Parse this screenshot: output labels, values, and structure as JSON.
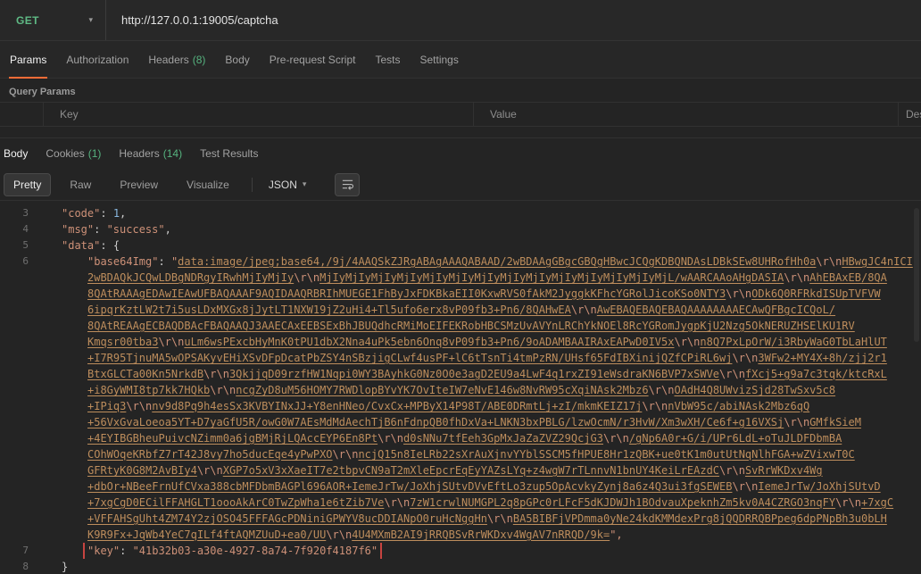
{
  "colors": {
    "accent": "#ff6c37",
    "method_get": "#5fba85",
    "count_green": "#56b37f",
    "string": "#ce9178",
    "link": "#bd8d5c",
    "number": "#89b8e0",
    "punct": "#cccccc",
    "line_number": "#6f6f6f",
    "highlight_red": "#c74440"
  },
  "request": {
    "method": "GET",
    "url": "http://127.0.0.1:19005/captcha",
    "tabs": [
      {
        "label": "Params",
        "active": true
      },
      {
        "label": "Authorization"
      },
      {
        "label": "Headers",
        "count": "(8)"
      },
      {
        "label": "Body"
      },
      {
        "label": "Pre-request Script"
      },
      {
        "label": "Tests"
      },
      {
        "label": "Settings"
      }
    ],
    "query_params_label": "Query Params",
    "param_columns": [
      "Key",
      "Value",
      "Description"
    ]
  },
  "response": {
    "tabs": [
      {
        "label": "Body",
        "active": true
      },
      {
        "label": "Cookies",
        "count": "(1)"
      },
      {
        "label": "Headers",
        "count": "(14)"
      },
      {
        "label": "Test Results"
      }
    ],
    "views": [
      {
        "label": "Pretty",
        "active": true
      },
      {
        "label": "Raw"
      },
      {
        "label": "Preview"
      },
      {
        "label": "Visualize"
      }
    ],
    "format": "JSON",
    "body_lines": [
      {
        "num": "3",
        "ind": 1,
        "parts": [
          [
            "k",
            "\"code\""
          ],
          [
            "p",
            ": "
          ],
          [
            "n",
            "1"
          ],
          [
            "p",
            ","
          ]
        ]
      },
      {
        "num": "4",
        "ind": 1,
        "parts": [
          [
            "k",
            "\"msg\""
          ],
          [
            "p",
            ": "
          ],
          [
            "s",
            "\"success\""
          ],
          [
            "p",
            ","
          ]
        ]
      },
      {
        "num": "5",
        "ind": 1,
        "parts": [
          [
            "k",
            "\"data\""
          ],
          [
            "p",
            ": "
          ],
          [
            "p",
            "{"
          ]
        ]
      },
      {
        "num": "6",
        "ind": 2,
        "parts": [
          [
            "k",
            "\"base64Img\""
          ],
          [
            "p",
            ": "
          ],
          [
            "s",
            "\""
          ],
          [
            "l",
            "data:image/jpeg;base64,/9j/4AAQSkZJRgABAgAAAQABAAD/2wBDAAgGBgcGBQgHBwcJCQgKDBQNDAsLDBkSEw8UHRofHh0a"
          ],
          [
            "c",
            "\\r\\n"
          ],
          [
            "l",
            "HBwgJC4nICI"
          ]
        ]
      },
      {
        "num": "",
        "ind": 2,
        "parts": [
          [
            "l",
            "2wBDAQkJCQwLDBgNDRgyIRwhMjIyMjIy"
          ],
          [
            "c",
            "\\r\\n"
          ],
          [
            "l",
            "MjIyMjIyMjIyMjIyMjIyMjIyMjIyMjIyMjIyMjIyMjIyMjIyMjIyMjL/wAARCAAoAHgDASIA"
          ],
          [
            "c",
            "\\r\\n"
          ],
          [
            "l",
            "AhEBAxEB/8QA"
          ]
        ]
      },
      {
        "num": "",
        "ind": 2,
        "parts": [
          [
            "l",
            "8QAtRAAAgEDAwIEAwUFBAQAAAF9AQIDAAQRBRIhMUEGE1FhByJxFDKBkaEII0KxwRVS0fAkM2JyggkKFhcYGRolJicoKSo0NTY3"
          ],
          [
            "c",
            "\\r\\n"
          ],
          [
            "l",
            "ODk6Q0RFRkdISUpTVFVW"
          ]
        ]
      },
      {
        "num": "",
        "ind": 2,
        "parts": [
          [
            "l",
            "6ipqrKztLW2t7i5usLDxMXGx8jJytLT1NXW19jZ2uHi4+Tl5ufo6erx8vP09fb3+Pn6/8QAHwEA"
          ],
          [
            "c",
            "\\r\\n"
          ],
          [
            "l",
            "AwEBAQEBAQEBAQAAAAAAAAECAwQFBgcICQoL/"
          ]
        ]
      },
      {
        "num": "",
        "ind": 2,
        "parts": [
          [
            "l",
            "8QAtREAAgECBAQDBAcFBAQAAQJ3AAECAxEEBSExBhJBUQdhcRMiMoEIFEKRobHBCSMzUvAVYnLRChYkNOEl8RcYGRomJygpKjU2Nzg5OkNERUZHSElKU1RV"
          ]
        ]
      },
      {
        "num": "",
        "ind": 2,
        "parts": [
          [
            "l",
            "Kmqsr00tba3"
          ],
          [
            "c",
            "\\r\\n"
          ],
          [
            "l",
            "uLm6wsPExcbHyMnK0tPU1dbX2Nna4uPk5ebn6Onq8vP09fb3+Pn6/9oADAMBAAIRAxEAPwD0IV5x"
          ],
          [
            "c",
            "\\r\\n"
          ],
          [
            "l",
            "n8Q7PxLpOrW/i3RbyWaG0TbLaHlUT"
          ]
        ]
      },
      {
        "num": "",
        "ind": 2,
        "parts": [
          [
            "l",
            "+I7R95TjnuMA5wOPSAKyvEHiXSvDFpDcatPbZSY4nSBzjigCLwf4usPF+lC6tTsnTi4tmPzRN/UHsf65FdIBXinijQZfCPiRL6wj"
          ],
          [
            "c",
            "\\r\\n"
          ],
          [
            "l",
            "3WFw2+MY4X+8h/zjj2r1"
          ]
        ]
      },
      {
        "num": "",
        "ind": 2,
        "parts": [
          [
            "l",
            "BtxGLCTa00Kn5NrkdB"
          ],
          [
            "c",
            "\\r\\n"
          ],
          [
            "l",
            "3QkjjqD09rzfHW1Nqpi0WY3BAyhkG0Nz0O0e3agD2EU9a4LwF4q1rxZI91eWsdraKN6BVP7xSWVe"
          ],
          [
            "c",
            "\\r\\n"
          ],
          [
            "l",
            "fXcj5+g9a7c3tqk/ktcRxL"
          ]
        ]
      },
      {
        "num": "",
        "ind": 2,
        "parts": [
          [
            "l",
            "+i8GyWMI8tp7kk7HQkb"
          ],
          [
            "c",
            "\\r\\n"
          ],
          [
            "l",
            "ncgZyD8uM56HOMY7RWDlopBYvYK7OvIteIW7eNvE146w8NvRW95cXqiNAsk2Mbz6"
          ],
          [
            "c",
            "\\r\\n"
          ],
          [
            "l",
            "OAdH4Q8UWvizSjd28TwSxv5c8"
          ]
        ]
      },
      {
        "num": "",
        "ind": 2,
        "parts": [
          [
            "l",
            "+IPiq3"
          ],
          [
            "c",
            "\\r\\n"
          ],
          [
            "l",
            "nv9d8Pq9h4esSx3KVBYINxJJ+Y8enHNeo/CvxCx+MPByX14P98T/ABE0DRmtLj+zI/mkmKEIZ17j"
          ],
          [
            "c",
            "\\r\\n"
          ],
          [
            "l",
            "nVbW95c/abiNAsk2Mbz6qQ"
          ]
        ]
      },
      {
        "num": "",
        "ind": 2,
        "parts": [
          [
            "l",
            "+56VxGvaLoeoa5YT+D7yaGfU5R/owG0W7AEsMdMdAechTjB6nFdnpQB0fhDxVa+LNKN3bxPBLG/lzwOcmN/r3HvW/Xm3wXH/Ce6f+g16VXSj"
          ],
          [
            "c",
            "\\r\\n"
          ],
          [
            "l",
            "GMfkSieM"
          ]
        ]
      },
      {
        "num": "",
        "ind": 2,
        "parts": [
          [
            "l",
            "+4EYIBGBheuPuivcNZimm0a6jgBMjRjLQAccEYP6En8Pt"
          ],
          [
            "c",
            "\\r\\n"
          ],
          [
            "l",
            "d0sNNu7tfEeh3GpMxJaZaZVZ29QcjG3"
          ],
          [
            "c",
            "\\r\\n"
          ],
          [
            "l",
            "/gNp6A0r+G/i/UPr6LdL+oTuJLDFDbmBA"
          ]
        ]
      },
      {
        "num": "",
        "ind": 2,
        "parts": [
          [
            "l",
            "COhWOqeKRbfZ7rT42J8vy7ho5ducEqe4yPwPXO"
          ],
          [
            "c",
            "\\r\\n"
          ],
          [
            "l",
            "ncjQ15n8IeLRb22sXrAuXjnvYYblSSCM5fHPUE8Hr1zQBK+ue0tK1m0utUtNqNlhFGA+wZVixwT0C"
          ]
        ]
      },
      {
        "num": "",
        "ind": 2,
        "parts": [
          [
            "l",
            "GFRtyK0G8M2AvBIy4"
          ],
          [
            "c",
            "\\r\\n"
          ],
          [
            "l",
            "XGP7o5xV3xXaeIT7e2tbpvCN9aT2mXleEpcrEqEyYAZsLYq+z4wgW7rTLnnvN1bnUY4KeiLrEAzdC"
          ],
          [
            "c",
            "\\r\\n"
          ],
          [
            "l",
            "SvRrWKDxv4Wg"
          ]
        ]
      },
      {
        "num": "",
        "ind": 2,
        "parts": [
          [
            "l",
            "+dbOr+NBeeFrnUfCVxa388cbMFDbmBAGPl696AOR+IemeJrTw/JoXhjSUtvDVvEftLo3zup5OpAcvkyZynj8a6z4Q3ui3fgSEWEB"
          ],
          [
            "c",
            "\\r\\n"
          ],
          [
            "l",
            "IemeJrTw/JoXhjSUtvD"
          ]
        ]
      },
      {
        "num": "",
        "ind": 2,
        "parts": [
          [
            "l",
            "+7xgCgD0ECilFFAHGLT1oooAkArC0TwZpWha1e6tZib7Ve"
          ],
          [
            "c",
            "\\r\\n"
          ],
          [
            "l",
            "7zW1crwlNUMGPL2q8pGPc0rLFcF5dKJDWJh1BOdvauXpeknhZm5kv0A4CZRGO3nqFY"
          ],
          [
            "c",
            "\\r\\n"
          ],
          [
            "l",
            "+7xgC"
          ]
        ]
      },
      {
        "num": "",
        "ind": 2,
        "parts": [
          [
            "l",
            "+VFFAHSgUht4ZM74Y2zjOSO45FFFAGcPDNiniGPWYV8ucDDIANpO0ruHcNggHn"
          ],
          [
            "c",
            "\\r\\n"
          ],
          [
            "l",
            "BA5BIBFjVPDmma0yNe24kdKMMdexPrg8jQQDRRQBPpeg6dpPNpBh3u0bLH"
          ]
        ]
      },
      {
        "num": "",
        "ind": 2,
        "parts": [
          [
            "l",
            "K9R9Fx+JqWb4YeC7qILf4ftAQMZUuD+ea0/UU"
          ],
          [
            "c",
            "\\r\\n"
          ],
          [
            "l",
            "4U4MXmB2AI9jRRQBSvRrWKDxv4WgAV7nRRQD/9k="
          ],
          [
            "s",
            "\","
          ]
        ]
      },
      {
        "num": "7",
        "ind": 2,
        "hl": true,
        "parts": [
          [
            "k",
            "\"key\""
          ],
          [
            "p",
            ": "
          ],
          [
            "s",
            "\"41b32b03-a30e-4927-8a74-7f920f4187f6\""
          ]
        ]
      },
      {
        "num": "8",
        "ind": 1,
        "parts": [
          [
            "p",
            "}"
          ]
        ]
      }
    ]
  }
}
